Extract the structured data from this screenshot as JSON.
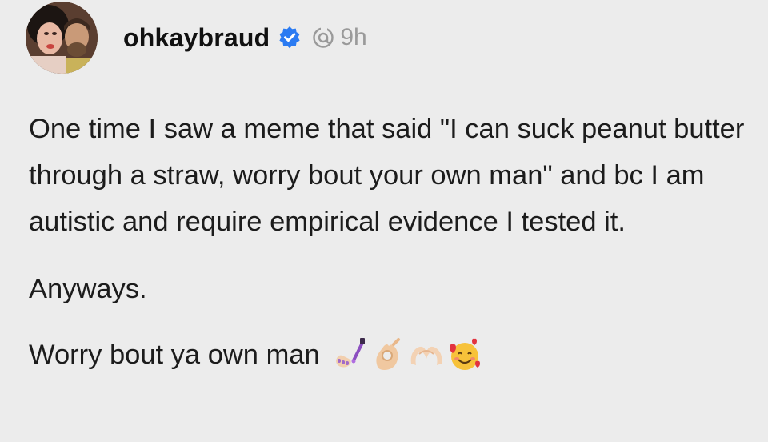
{
  "post": {
    "username": "ohkaybraud",
    "timestamp": "9h",
    "paragraphs": [
      "One time I saw a meme that said \"I can suck peanut butter through a straw, worry bout your own man\" and bc I am autistic and require empirical evidence I tested it.",
      "Anyways.",
      "Worry bout ya own man"
    ],
    "emojis": [
      "nail-polish-icon",
      "ok-hand-icon",
      "heart-hands-icon",
      "smiling-face-with-hearts-icon"
    ]
  },
  "colors": {
    "background": "#ececec",
    "verified": "#2b7bf2",
    "muted": "#9a9a9a"
  }
}
